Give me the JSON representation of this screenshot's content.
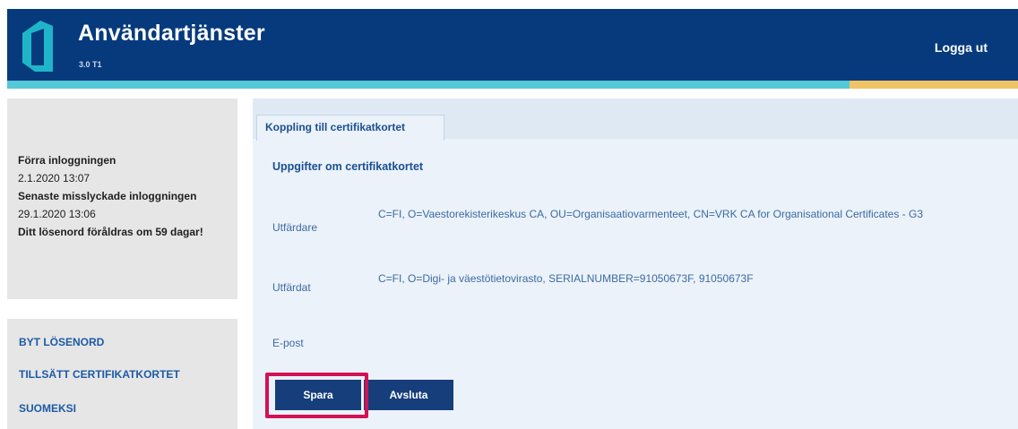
{
  "header": {
    "app_title": "Användartjänster",
    "version": "3.0 T1",
    "logout_label": "Logga ut"
  },
  "colors": {
    "header_bg": "#063a7d",
    "accent_teal": "#55c8d8",
    "accent_gold": "#f0c466",
    "button_bg": "#163e7b",
    "highlight": "#d31155"
  },
  "sidebar": {
    "previous_login_label": "Förra inloggningen",
    "previous_login_time": "2.1.2020 13:07",
    "failed_login_label": "Senaste misslyckade inloggningen",
    "failed_login_time": "29.1.2020 13:06",
    "password_expiry": "Ditt lösenord föråldras om 59 dagar!",
    "nav": [
      "BYT LÖSENORD",
      "TILLSÄTT CERTIFIKATKORTET",
      "SUOMEKSI"
    ]
  },
  "main": {
    "tab_label": "Koppling till certifikatkortet",
    "section_title": "Uppgifter om certifikatkortet",
    "fields": [
      {
        "label": "Utfärdare",
        "value": "C=FI, O=Vaestorekisterikeskus CA, OU=Organisaatiovarmenteet, CN=VRK CA for Organisational Certificates - G3"
      },
      {
        "label": "Utfärdat",
        "value": "C=FI, O=Digi- ja väestötietovirasto, SERIALNUMBER=91050673F, 91050673F"
      },
      {
        "label": "E-post",
        "value": ""
      }
    ],
    "save_label": "Spara",
    "cancel_label": "Avsluta"
  }
}
